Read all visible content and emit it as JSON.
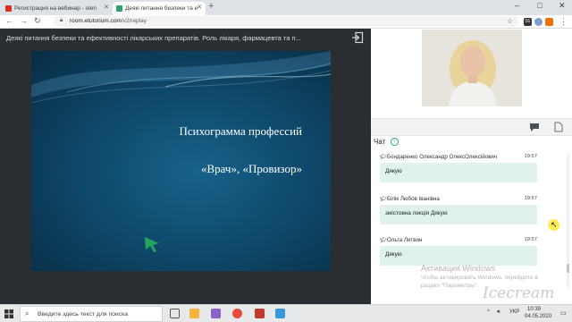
{
  "browser": {
    "tabs": [
      {
        "title": "Регистрация на вебинар - olen",
        "favicon_color": "#d93025",
        "active": false
      },
      {
        "title": "Деякі питання безпеки та е",
        "favicon_color": "#2ea36a",
        "active": true
      }
    ],
    "new_tab_label": "+",
    "window_controls": [
      "–",
      "□",
      "✕"
    ],
    "url_host": "room.etutorium.com",
    "url_path": "/v2/replay",
    "extensions": [
      "01"
    ]
  },
  "webinar": {
    "title": "Деякі питання безпеки та ефективності лікарських препаратів. Роль лікаря, фармацевта та п...",
    "exit_icon": "exit-icon"
  },
  "slide": {
    "title": "Психограмма профессий",
    "subtitle": "«Врач», «Провизор»",
    "background_color": "#0f4a6c"
  },
  "chat": {
    "header": "Чат",
    "messages": [
      {
        "author": "Бондаренко Олександр ОлексОлексійович",
        "time": "19:57",
        "text": "Дякую"
      },
      {
        "author": "Білік Любов Іванівна",
        "time": "19:57",
        "text": "змістовна лекція Дякую"
      },
      {
        "author": "Ольга Литвин",
        "time": "19:57",
        "text": "Дякую"
      }
    ],
    "bubble_color": "#dff3ea"
  },
  "overlay": {
    "activation_title": "Активация Windows",
    "activation_line1": "Чтобы активировать Windows, перейдите в",
    "activation_line2": "раздел \"Параметры\".",
    "recorder_mark": "Icecream"
  },
  "taskbar": {
    "search_placeholder": "Введите здесь текст для поиска",
    "language": "УКР",
    "time": "10:39",
    "date": "04.05.2020"
  }
}
